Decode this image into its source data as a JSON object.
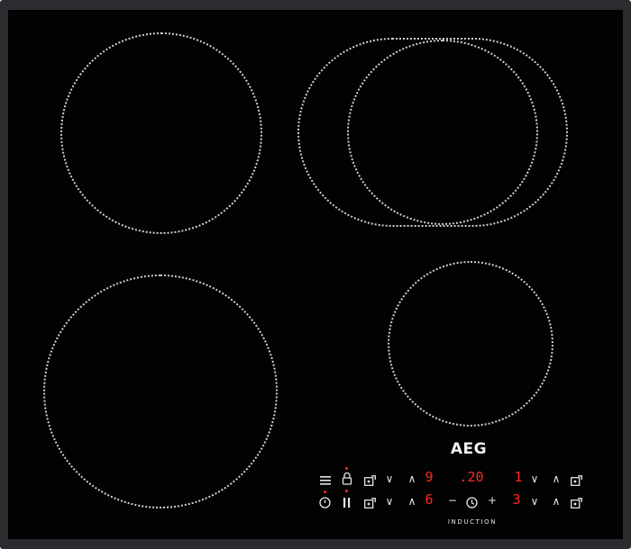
{
  "brand": {
    "logo": "AEG",
    "subtitle": "INDUCTION"
  },
  "controls": {
    "row1": {
      "zone_left_level": "9",
      "timer_display": ".20",
      "zone_right_level": "1",
      "down_label": "∨",
      "up_label": "∧"
    },
    "row2": {
      "zone_left_level": "6",
      "timer_minus": "−",
      "timer_plus": "+",
      "zone_right_level": "3",
      "down_label": "∨",
      "up_label": "∧"
    }
  },
  "icons": [
    "hob2hood-icon",
    "lock-icon",
    "zone-select-icon",
    "power-icon",
    "pause-icon",
    "timer-clock-icon"
  ],
  "colors": {
    "glass": "#020203",
    "frame": "#2a2c30",
    "display": "#ff2a1f",
    "zone_outline": "#cfcfcf"
  }
}
